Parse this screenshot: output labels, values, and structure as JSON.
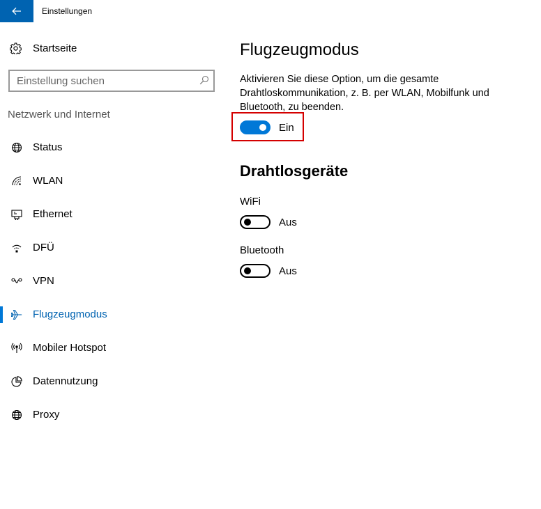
{
  "window": {
    "title": "Einstellungen"
  },
  "sidebar": {
    "home_label": "Startseite",
    "search_placeholder": "Einstellung suchen",
    "section_label": "Netzwerk und Internet",
    "items": [
      {
        "label": "Status",
        "icon": "globe-status-icon"
      },
      {
        "label": "WLAN",
        "icon": "wifi-icon"
      },
      {
        "label": "Ethernet",
        "icon": "ethernet-icon"
      },
      {
        "label": "DFÜ",
        "icon": "dialup-icon"
      },
      {
        "label": "VPN",
        "icon": "vpn-icon"
      },
      {
        "label": "Flugzeugmodus",
        "icon": "airplane-icon",
        "selected": true
      },
      {
        "label": "Mobiler Hotspot",
        "icon": "hotspot-icon"
      },
      {
        "label": "Datennutzung",
        "icon": "data-usage-icon"
      },
      {
        "label": "Proxy",
        "icon": "globe-icon"
      }
    ]
  },
  "main": {
    "title": "Flugzeugmodus",
    "description": "Aktivieren Sie diese Option, um die gesamte Drahtloskommunikation, z. B. per WLAN, Mobilfunk und Bluetooth, zu beenden.",
    "airplane_toggle": {
      "state_label": "Ein",
      "on": true
    },
    "wireless_title": "Drahtlosgeräte",
    "devices": [
      {
        "label": "WiFi",
        "state_label": "Aus",
        "on": false
      },
      {
        "label": "Bluetooth",
        "state_label": "Aus",
        "on": false
      }
    ]
  },
  "colors": {
    "accent": "#0078d7",
    "titlebar_back": "#0063b1",
    "highlight": "#d40000"
  }
}
